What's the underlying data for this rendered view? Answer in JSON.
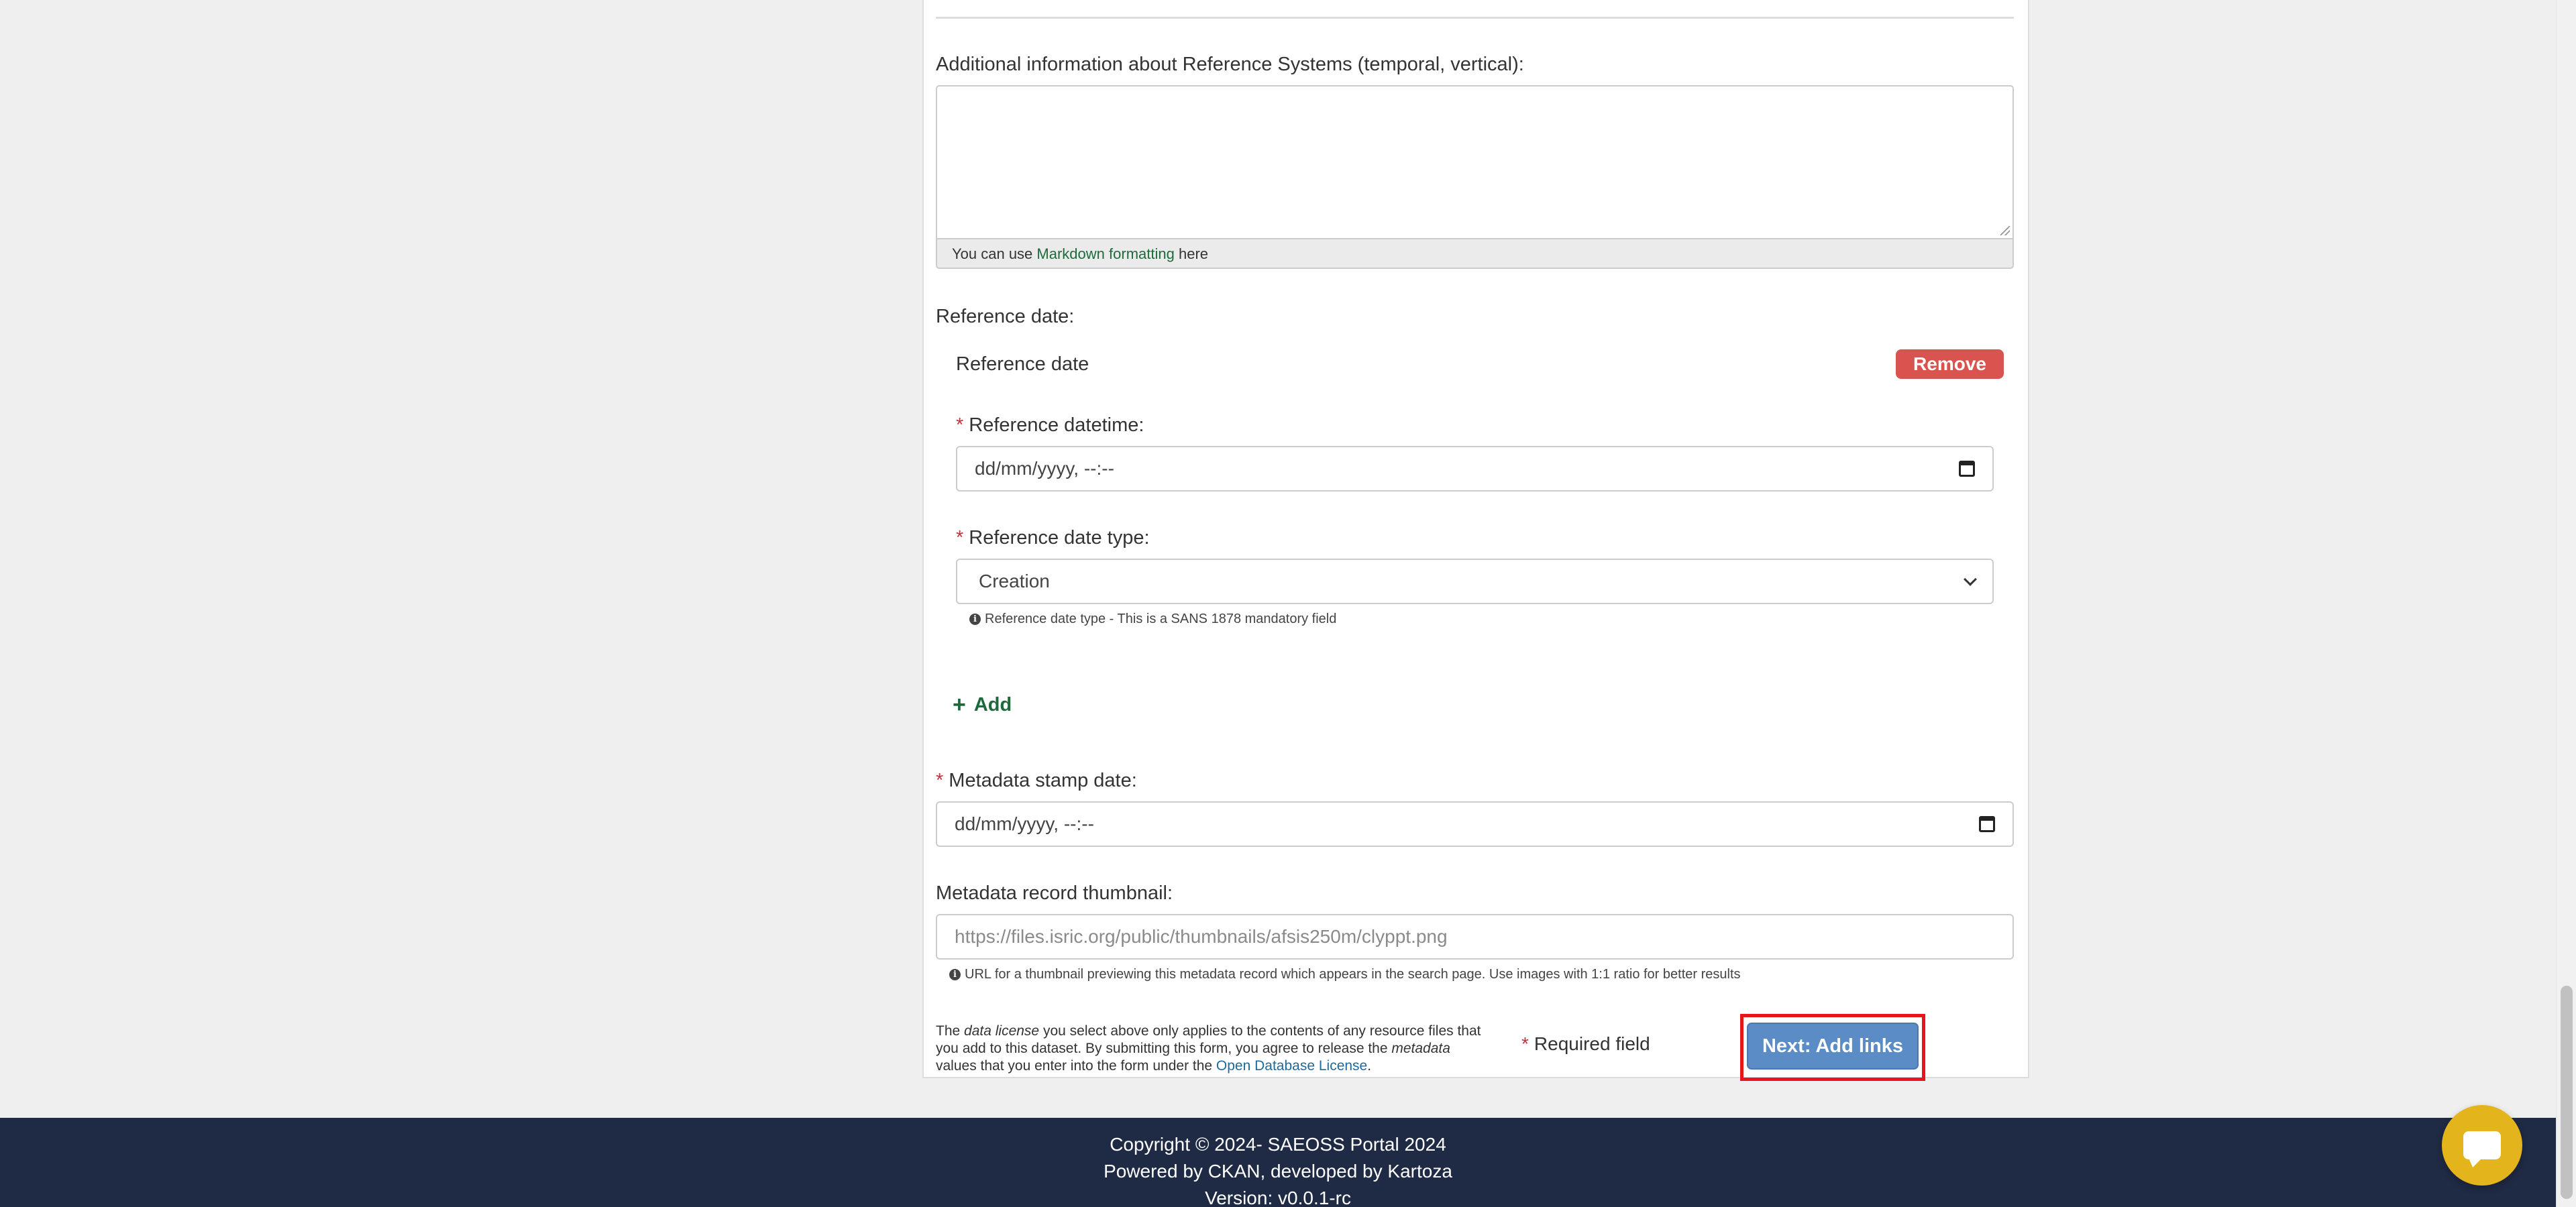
{
  "form": {
    "additional_info_label": "Additional information about Reference Systems (temporal, vertical):",
    "markdown_hint_prefix": "You can use",
    "markdown_hint_link": "Markdown formatting",
    "markdown_hint_suffix": "here",
    "reference_date_label": "Reference date:",
    "reference_date_group": {
      "title": "Reference date",
      "remove_label": "Remove",
      "datetime_label": "Reference datetime:",
      "datetime_value": "dd/mm/yyyy, --:--",
      "type_label": "Reference date type:",
      "type_value": "Creation",
      "type_hint": "Reference date type - This is a SANS 1878 mandatory field"
    },
    "add_label": "Add",
    "metadata_stamp_label": "Metadata stamp date:",
    "metadata_stamp_value": "dd/mm/yyyy, --:--",
    "thumbnail_label": "Metadata record thumbnail:",
    "thumbnail_placeholder": "https://files.isric.org/public/thumbnails/afsis250m/clyppt.png",
    "thumbnail_hint": "URL for a thumbnail previewing this metadata record which appears in the search page. Use images with 1:1 ratio for better results",
    "required_asterisk": "*",
    "required_field_label": "Required field",
    "next_button_label": "Next: Add links"
  },
  "license": {
    "t1": "The ",
    "t2": "data license",
    "t3": " you select above only applies to the contents of any resource files that you add to this dataset. By submitting this form, you agree to release the ",
    "t4": "metadata",
    "t5": " values that you enter into the form under the ",
    "link": "Open Database License",
    "t6": "."
  },
  "footer": {
    "copyright": "Copyright © 2024- SAEOSS Portal 2024",
    "powered": "Powered by CKAN, developed by Kartoza",
    "version": "Version: v0.0.1-rc"
  },
  "icons": {
    "calendar": "calendar-icon",
    "chevron": "chevron-down-icon",
    "info": "info-icon",
    "plus": "plus-icon",
    "chat": "chat-icon"
  },
  "colors": {
    "required": "#c6303e",
    "remove": "#d9534f",
    "next_button": "#5b8cc6",
    "highlight_outline": "#e8141b",
    "footer": "#1f2a44",
    "chat": "#e3b41c",
    "link_green": "#1e6a3c"
  }
}
